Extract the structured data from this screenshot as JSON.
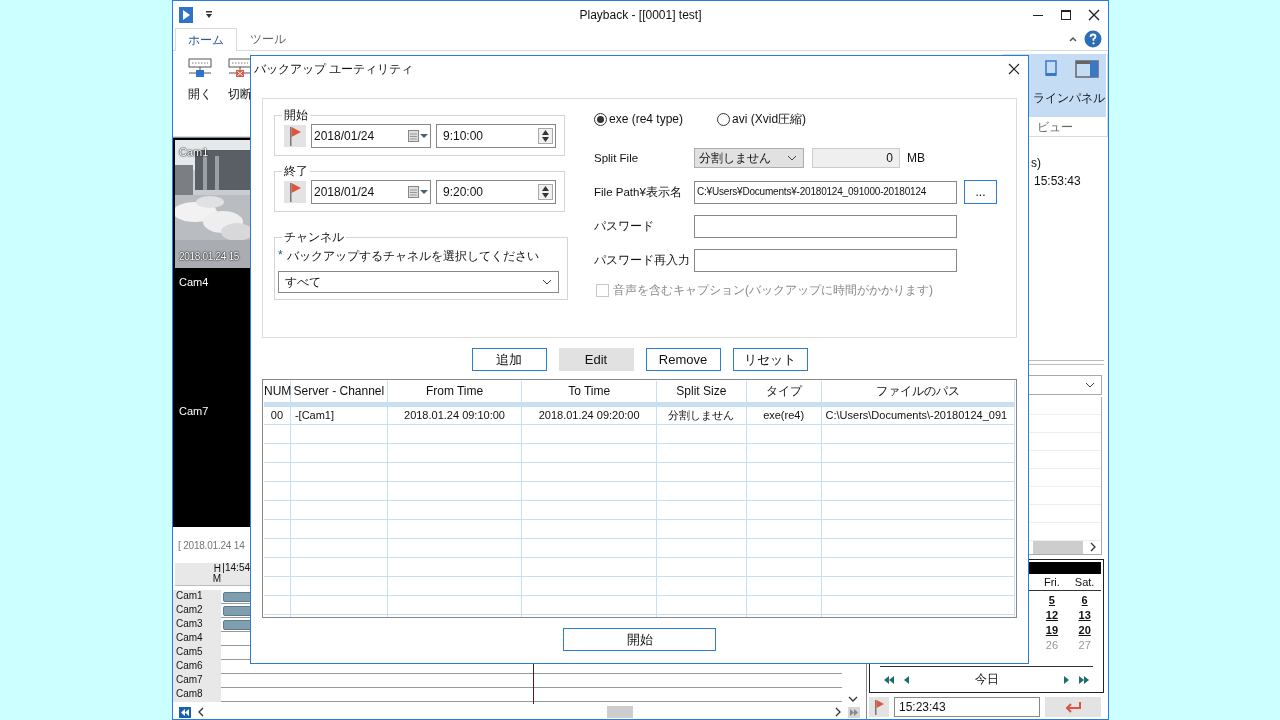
{
  "window": {
    "title": "Playback - [[0001] test]"
  },
  "ribbon": {
    "tabs": [
      {
        "label": "ホーム",
        "selected": true
      },
      {
        "label": "ツール",
        "selected": false
      }
    ],
    "left_buttons": [
      {
        "label": "開く",
        "kind": "open"
      },
      {
        "label": "切断",
        "kind": "disconnect"
      }
    ],
    "right_buttons": [
      {
        "label": "ライン",
        "kind": "layout"
      },
      {
        "label": "パネル",
        "kind": "panel"
      }
    ],
    "group_label": "ビュー"
  },
  "video": {
    "tiles": [
      {
        "label": "Cam1",
        "kind": "picture",
        "timestamp": "2018.01.24 15"
      },
      {
        "label": "Cam4",
        "kind": "empty"
      },
      {
        "label": "Cam7",
        "kind": "empty"
      }
    ]
  },
  "timeline": {
    "range_text": "[ 2018.01.24 14",
    "hour_label": "H",
    "minute_label": "M",
    "start_time": "14:54",
    "channels": [
      {
        "name": "Cam1",
        "has_recording": true
      },
      {
        "name": "Cam2",
        "has_recording": true
      },
      {
        "name": "Cam3",
        "has_recording": true
      },
      {
        "name": "Cam4",
        "has_recording": false
      },
      {
        "name": "Cam5",
        "has_recording": false
      },
      {
        "name": "Cam6",
        "has_recording": false
      },
      {
        "name": "Cam7",
        "has_recording": false
      },
      {
        "name": "Cam8",
        "has_recording": false
      }
    ]
  },
  "side_panel": {
    "info_line_1": "s)",
    "info_line_2": "15:53:43",
    "calendar": {
      "weekdays": [
        "Fri.",
        "Sat."
      ],
      "days": [
        {
          "day": "5",
          "has_recording": true
        },
        {
          "day": "6",
          "has_recording": true
        },
        {
          "day": "12",
          "has_recording": true
        },
        {
          "day": "13",
          "has_recording": true
        },
        {
          "day": "19",
          "has_recording": true
        },
        {
          "day": "20",
          "has_recording": true
        },
        {
          "day": "26",
          "has_recording": false
        },
        {
          "day": "27",
          "has_recording": false
        }
      ],
      "today": "今日"
    },
    "time_field": "15:23:43"
  },
  "dialog": {
    "title": "バックアップ ユーティリティ",
    "start": {
      "legend": "開始",
      "date": "2018/01/24",
      "time": "9:10:00"
    },
    "end": {
      "legend": "終了",
      "date": "2018/01/24",
      "time": "9:20:00"
    },
    "channel": {
      "legend": "チャンネル",
      "required_mark": "*",
      "hint": "バックアップするチャネルを選択してください",
      "value": "すべて"
    },
    "formats": [
      {
        "label": "exe (re4 type)",
        "selected": true
      },
      {
        "label": "avi (Xvid圧縮)",
        "selected": false
      }
    ],
    "split_file": {
      "label": "Split File",
      "value": "分割しません",
      "size": "0",
      "unit": "MB"
    },
    "file_path": {
      "label": "File Path¥表示名",
      "value": "C:¥Users¥Documents¥-20180124_091000-20180124",
      "browse": "..."
    },
    "password": {
      "label": "パスワード"
    },
    "password_confirm": {
      "label": "パスワード再入力"
    },
    "audio_caption": {
      "label": "音声を含むキャプション(バックアップに時間がかかります)",
      "checked": false,
      "disabled": true
    },
    "buttons": [
      {
        "label": "追加",
        "disabled": false
      },
      {
        "label": "Edit",
        "disabled": true
      },
      {
        "label": "Remove",
        "disabled": false
      },
      {
        "label": "リセット",
        "disabled": false
      }
    ],
    "table": {
      "columns": [
        "NUM",
        "Server - Channel",
        "From Time",
        "To Time",
        "Split Size",
        "タイプ",
        "ファイルのパス"
      ],
      "rows": [
        {
          "selected": true,
          "cells": [
            "00",
            "-[Cam1]",
            "2018.01.24 09:10:00",
            "2018.01.24 09:20:00",
            "分割しません",
            "exe(re4)",
            "C:\\Users\\Documents\\-20180124_091"
          ]
        }
      ]
    },
    "start_button": "開始"
  }
}
